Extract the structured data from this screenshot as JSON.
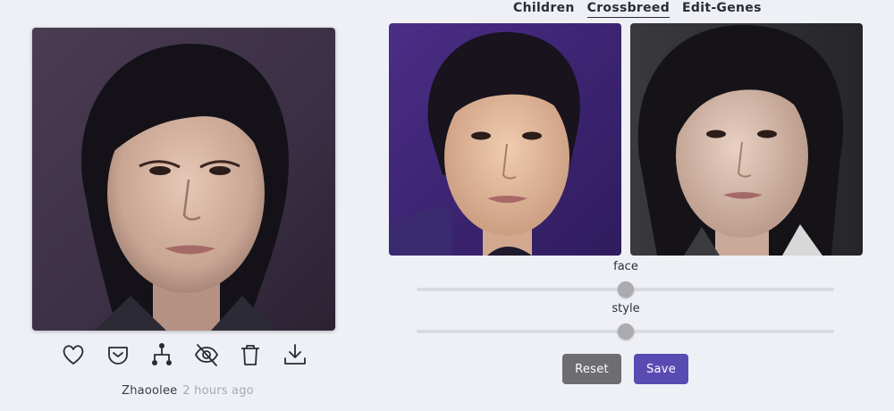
{
  "tabs": [
    {
      "label": "Children",
      "active": false
    },
    {
      "label": "Crossbreed",
      "active": true
    },
    {
      "label": "Edit-Genes",
      "active": false
    }
  ],
  "result": {
    "image": "generated blended face portrait",
    "actions": [
      "heart-icon",
      "pocket-save-icon",
      "family-tree-icon",
      "eye-off-icon",
      "trash-icon",
      "download-icon"
    ],
    "author": "Zhaoolee",
    "time_ago": "2 hours ago"
  },
  "parents": [
    {
      "image": "parent face A on purple background"
    },
    {
      "image": "parent face B on dark background"
    }
  ],
  "sliders": [
    {
      "label": "face",
      "value": 0.5
    },
    {
      "label": "style",
      "value": 0.5
    }
  ],
  "buttons": {
    "reset": "Reset",
    "save": "Save"
  },
  "colors": {
    "background": "#eef0f6",
    "save_button": "#5a4bb3",
    "reset_button": "#6d6d72",
    "slider_thumb": "#aaaaaf"
  }
}
